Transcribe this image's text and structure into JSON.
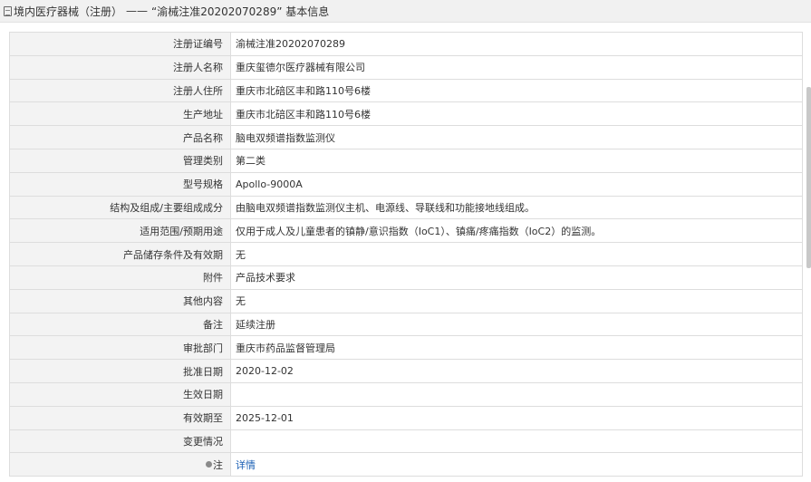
{
  "header": {
    "breadcrumb": "境内医疗器械（注册）",
    "separator": "——",
    "record_title": "“渝械注准20202070289” 基本信息"
  },
  "rows": [
    {
      "label": "注册证编号",
      "value": "渝械注准20202070289"
    },
    {
      "label": "注册人名称",
      "value": "重庆玺德尔医疗器械有限公司"
    },
    {
      "label": "注册人住所",
      "value": "重庆市北碚区丰和路110号6楼"
    },
    {
      "label": "生产地址",
      "value": "重庆市北碚区丰和路110号6楼"
    },
    {
      "label": "产品名称",
      "value": "脑电双频谱指数监测仪"
    },
    {
      "label": "管理类别",
      "value": "第二类"
    },
    {
      "label": "型号规格",
      "value": "Apollo-9000A"
    },
    {
      "label": "结构及组成/主要组成成分",
      "value": "由脑电双频谱指数监测仪主机、电源线、导联线和功能接地线组成。"
    },
    {
      "label": "适用范围/预期用途",
      "value": "仅用于成人及儿童患者的镇静/意识指数（IoC1）、镇痛/疼痛指数（IoC2）的监测。"
    },
    {
      "label": "产品储存条件及有效期",
      "value": "无"
    },
    {
      "label": "附件",
      "value": "产品技术要求"
    },
    {
      "label": "其他内容",
      "value": "无"
    },
    {
      "label": "备注",
      "value": "延续注册"
    },
    {
      "label": "审批部门",
      "value": "重庆市药品监督管理局"
    },
    {
      "label": "批准日期",
      "value": "2020-12-02"
    },
    {
      "label": "生效日期",
      "value": ""
    },
    {
      "label": "有效期至",
      "value": "2025-12-01"
    },
    {
      "label": "变更情况",
      "value": ""
    },
    {
      "label": "注",
      "value": "详情"
    }
  ],
  "colors": {
    "header_bg": "#f1f1f1",
    "label_bg": "#f3f3f3",
    "border": "#dddddd",
    "link": "#1a5fb4"
  }
}
